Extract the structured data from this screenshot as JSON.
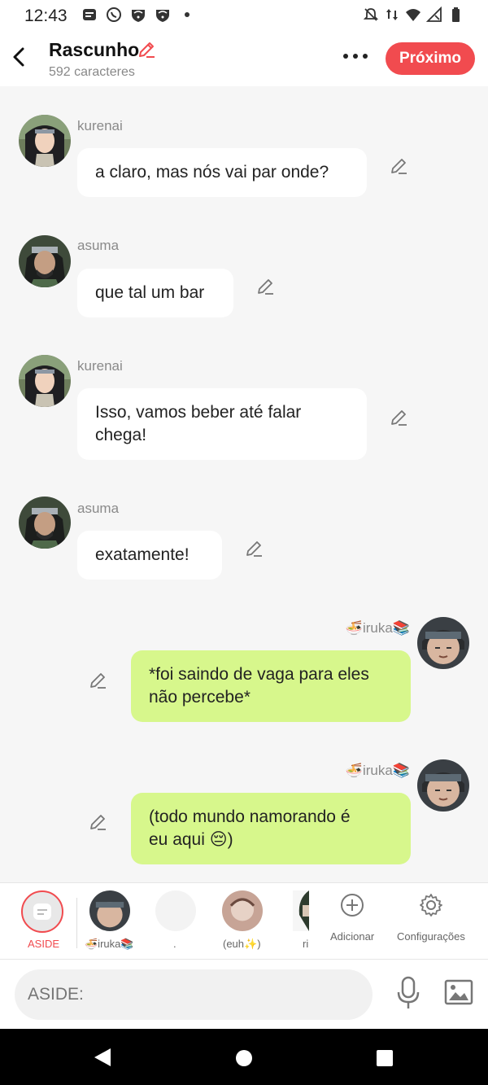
{
  "status": {
    "time": "12:43"
  },
  "header": {
    "title": "Rascunho",
    "subtitle": "592 caracteres",
    "next_label": "Próximo"
  },
  "messages": [
    {
      "name": "kurenai",
      "lines": [
        "a claro, mas nós vai par onde?"
      ]
    },
    {
      "name": "asuma",
      "lines": [
        "que tal um bar"
      ]
    },
    {
      "name": "kurenai",
      "lines": [
        "Isso, vamos beber até falar",
        "chega!"
      ]
    },
    {
      "name": "asuma",
      "lines": [
        "exatamente!"
      ]
    },
    {
      "name": "🍜iruka📚",
      "lines": [
        "*foi saindo de vaga para eles",
        "não percebe*"
      ]
    },
    {
      "name": "🍜iruka📚",
      "lines": [
        "(todo mundo namorando é",
        "eu aqui 😔)"
      ]
    }
  ],
  "tools": {
    "aside": "ASIDE",
    "char1": "🍜iruka📚",
    "char2": ".",
    "char3": "(euh✨)",
    "char4": "ri",
    "add": "Adicionar",
    "settings": "Configurações"
  },
  "input": {
    "placeholder": "ASIDE:"
  },
  "colors": {
    "accent": "#f14b4f",
    "bubble_left": "#ffffff",
    "bubble_right": "#d7f78c"
  }
}
